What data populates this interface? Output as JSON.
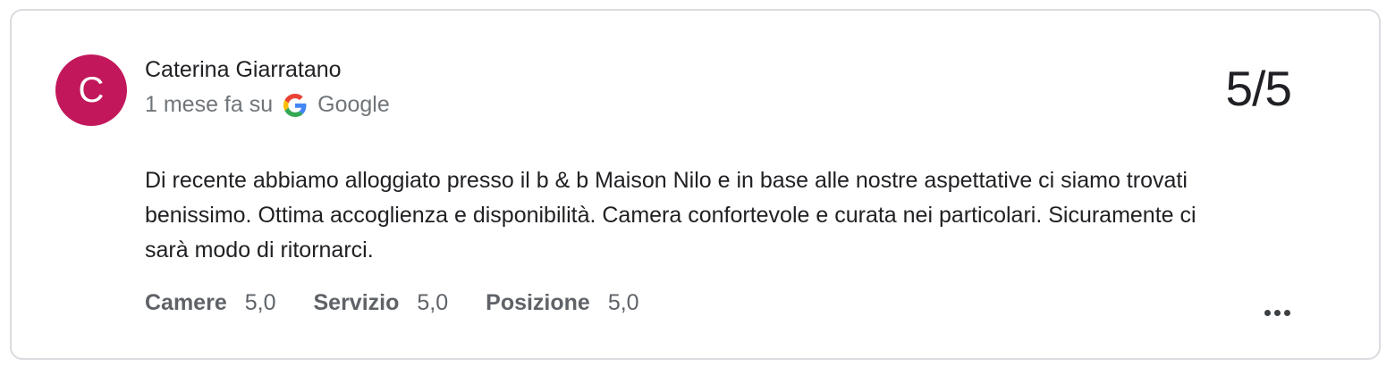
{
  "review": {
    "avatar_letter": "C",
    "avatar_color": "#c2185b",
    "author_name": "Caterina Giarratano",
    "time_ago": "1 mese fa su",
    "source": "Google",
    "source_icon": "google-g-icon",
    "score": "5/5",
    "text": "Di recente abbiamo alloggiato presso il b & b Maison Nilo e in base alle nostre aspettative ci siamo trovati benissimo. Ottima accoglienza e disponibilità. Camera confortevole e curata nei particolari. Sicuramente ci sarà modo di ritornarci.",
    "ratings": [
      {
        "label": "Camere",
        "value": "5,0"
      },
      {
        "label": "Servizio",
        "value": "5,0"
      },
      {
        "label": "Posizione",
        "value": "5,0"
      }
    ],
    "more_icon": "more-horizontal-icon"
  }
}
